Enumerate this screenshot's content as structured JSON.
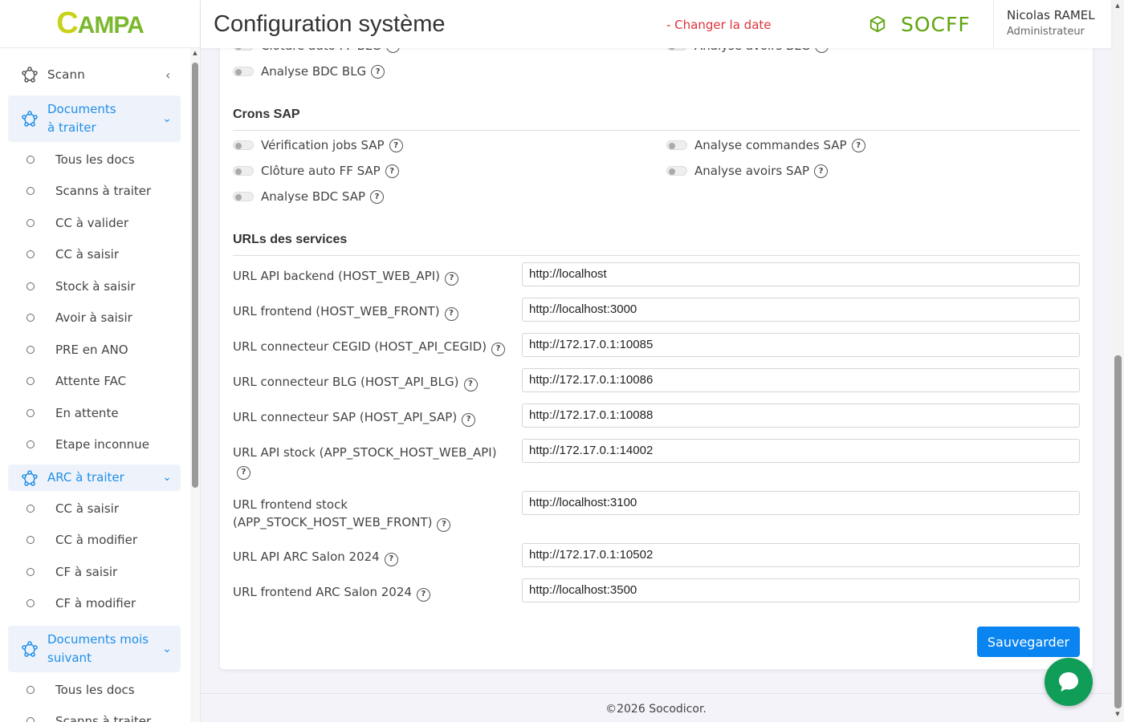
{
  "logo": {
    "c": "C",
    "rest": "AMPA"
  },
  "header": {
    "title": "Configuration système",
    "change_date": "- Changer la date",
    "company": "SOCFF",
    "user_name": "Nicolas RAMEL",
    "user_role": "Administrateur"
  },
  "sidebar": {
    "top_item": "Scann",
    "groups": [
      {
        "label": "Documents à traiter",
        "items": [
          "Tous les docs",
          "Scanns à traiter",
          "CC à valider",
          "CC à saisir",
          "Stock à saisir",
          "Avoir à saisir",
          "PRE en ANO",
          "Attente FAC",
          "En attente",
          "Etape inconnue"
        ]
      },
      {
        "label": "ARC à traiter",
        "items": [
          "CC à saisir",
          "CC à modifier",
          "CF à saisir",
          "CF à modifier"
        ]
      },
      {
        "label": "Documents mois suivant",
        "items": [
          "Tous les docs",
          "Scanns à traiter"
        ]
      }
    ]
  },
  "blg_partial": {
    "left": "Clôture auto FF BLG",
    "right": "Analyse avoirs BLG",
    "bdc": "Analyse BDC BLG"
  },
  "crons_sap": {
    "title": "Crons SAP",
    "toggles": [
      "Vérification jobs SAP",
      "Analyse commandes SAP",
      "Clôture auto FF SAP",
      "Analyse avoirs SAP",
      "Analyse BDC SAP"
    ]
  },
  "urls": {
    "title": "URLs des services",
    "rows": [
      {
        "label": "URL API backend (HOST_WEB_API)",
        "value": "http://localhost"
      },
      {
        "label": "URL frontend (HOST_WEB_FRONT)",
        "value": "http://localhost:3000"
      },
      {
        "label": "URL connecteur CEGID (HOST_API_CEGID)",
        "value": "http://172.17.0.1:10085"
      },
      {
        "label": "URL connecteur BLG (HOST_API_BLG)",
        "value": "http://172.17.0.1:10086"
      },
      {
        "label": "URL connecteur SAP (HOST_API_SAP)",
        "value": "http://172.17.0.1:10088"
      },
      {
        "label": "URL API stock (APP_STOCK_HOST_WEB_API)",
        "value": "http://172.17.0.1:14002"
      },
      {
        "label": "URL frontend stock (APP_STOCK_HOST_WEB_FRONT)",
        "value": "http://localhost:3100"
      },
      {
        "label": "URL API ARC Salon 2024",
        "value": "http://172.17.0.1:10502"
      },
      {
        "label": "URL frontend ARC Salon 2024",
        "value": "http://localhost:3500"
      }
    ]
  },
  "save_label": "Sauvegarder",
  "help_glyph": "?",
  "footer": "©2026 Socodicor.",
  "colors": {
    "accent": "#0a84f0",
    "company": "#5fa30e",
    "danger": "#e0323a",
    "chat": "#0f9d58"
  }
}
